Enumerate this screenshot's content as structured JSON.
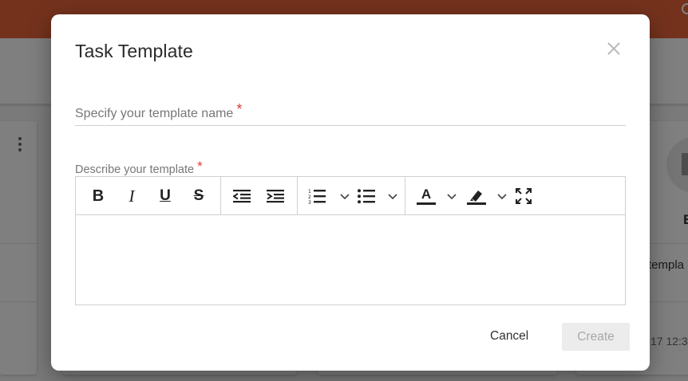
{
  "background": {
    "right_card_letter": "E",
    "right_card_text": "templa",
    "right_card_time": "17 12:3"
  },
  "dialog": {
    "title": "Task Template",
    "close_icon": "close-icon",
    "name_field": {
      "placeholder": "Specify your template name",
      "value": "",
      "required_mark": "*"
    },
    "description": {
      "label": "Describe your template",
      "required_mark": "*",
      "value": ""
    },
    "toolbar": {
      "items": [
        "bold-icon",
        "italic-icon",
        "underline-icon",
        "strikethrough-icon",
        "outdent-icon",
        "indent-icon",
        "ordered-list-icon",
        "bulleted-list-icon",
        "font-color-icon",
        "highlight-icon",
        "fullscreen-icon"
      ],
      "bold_glyph": "B",
      "italic_glyph": "I",
      "underline_glyph": "U",
      "strike_glyph": "S",
      "font_color_glyph": "A"
    },
    "buttons": {
      "cancel": "Cancel",
      "create": "Create"
    }
  },
  "colors": {
    "header": "#e8643a",
    "required": "#e53935",
    "create_disabled_bg": "#ececec"
  }
}
